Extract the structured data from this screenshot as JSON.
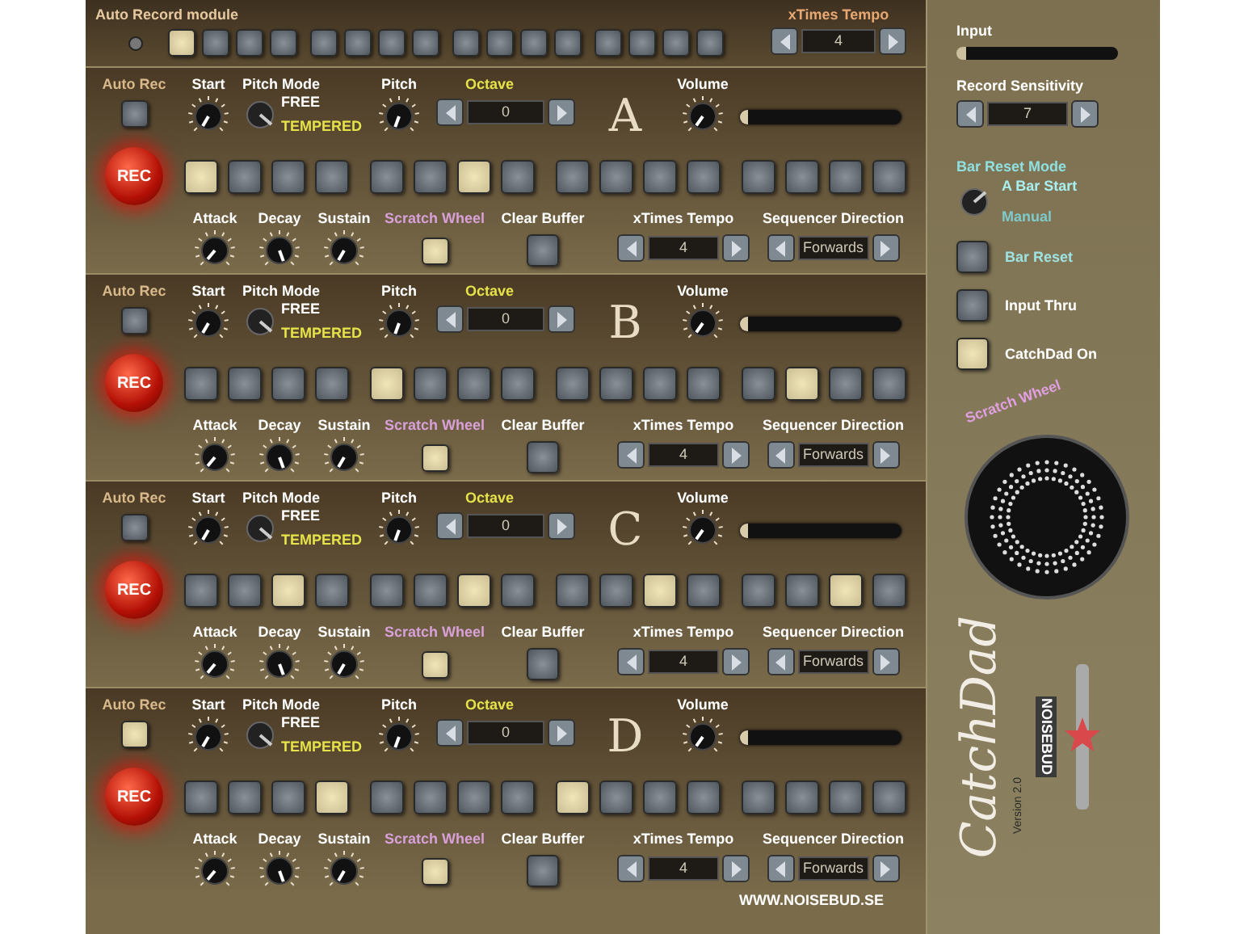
{
  "auto_record_module": {
    "title": "Auto Record module",
    "steps": [
      true,
      false,
      false,
      false,
      false,
      false,
      false,
      false,
      false,
      false,
      false,
      false,
      false,
      false,
      false,
      false
    ],
    "tempo": {
      "label": "xTimes Tempo",
      "value": "4"
    }
  },
  "tracks": [
    {
      "letter": "A",
      "volume_slider": {
        "level": 0.05
      },
      "auto_rec": {
        "label": "Auto Rec",
        "on": false
      },
      "start_label": "Start",
      "pitch_mode": {
        "label": "Pitch Mode",
        "options": [
          {
            "label": "FREE",
            "selected": false
          },
          {
            "label": "TEMPERED",
            "selected": true
          }
        ]
      },
      "pitch_label": "Pitch",
      "octave": {
        "label": "Octave",
        "value": "0"
      },
      "volume_label": "Volume",
      "rec": "REC",
      "steps": [
        true,
        false,
        false,
        false,
        false,
        false,
        true,
        false,
        false,
        false,
        false,
        false,
        false,
        false,
        false,
        false
      ],
      "attack_label": "Attack",
      "decay_label": "Decay",
      "sustain_label": "Sustain",
      "scratch_wheel": {
        "label": "Scratch Wheel",
        "on": true
      },
      "clear_buffer": "Clear Buffer",
      "tempo": {
        "label": "xTimes Tempo",
        "value": "4"
      },
      "direction": {
        "label": "Sequencer Direction",
        "value": "Forwards"
      }
    },
    {
      "letter": "B",
      "volume_slider": {
        "level": 0.05
      },
      "auto_rec": {
        "label": "Auto Rec",
        "on": false
      },
      "start_label": "Start",
      "pitch_mode": {
        "label": "Pitch Mode",
        "options": [
          {
            "label": "FREE",
            "selected": false
          },
          {
            "label": "TEMPERED",
            "selected": true
          }
        ]
      },
      "pitch_label": "Pitch",
      "octave": {
        "label": "Octave",
        "value": "0"
      },
      "volume_label": "Volume",
      "rec": "REC",
      "steps": [
        false,
        false,
        false,
        false,
        true,
        false,
        false,
        false,
        false,
        false,
        false,
        false,
        false,
        true,
        false,
        false
      ],
      "attack_label": "Attack",
      "decay_label": "Decay",
      "sustain_label": "Sustain",
      "scratch_wheel": {
        "label": "Scratch Wheel",
        "on": true
      },
      "clear_buffer": "Clear Buffer",
      "tempo": {
        "label": "xTimes Tempo",
        "value": "4"
      },
      "direction": {
        "label": "Sequencer Direction",
        "value": "Forwards"
      }
    },
    {
      "letter": "C",
      "volume_slider": {
        "level": 0.05
      },
      "auto_rec": {
        "label": "Auto Rec",
        "on": false
      },
      "start_label": "Start",
      "pitch_mode": {
        "label": "Pitch Mode",
        "options": [
          {
            "label": "FREE",
            "selected": false
          },
          {
            "label": "TEMPERED",
            "selected": true
          }
        ]
      },
      "pitch_label": "Pitch",
      "octave": {
        "label": "Octave",
        "value": "0"
      },
      "volume_label": "Volume",
      "rec": "REC",
      "steps": [
        false,
        false,
        true,
        false,
        false,
        false,
        true,
        false,
        false,
        false,
        true,
        false,
        false,
        false,
        true,
        false
      ],
      "attack_label": "Attack",
      "decay_label": "Decay",
      "sustain_label": "Sustain",
      "scratch_wheel": {
        "label": "Scratch Wheel",
        "on": true
      },
      "clear_buffer": "Clear Buffer",
      "tempo": {
        "label": "xTimes Tempo",
        "value": "4"
      },
      "direction": {
        "label": "Sequencer Direction",
        "value": "Forwards"
      }
    },
    {
      "letter": "D",
      "volume_slider": {
        "level": 0.05
      },
      "auto_rec": {
        "label": "Auto Rec",
        "on": true
      },
      "start_label": "Start",
      "pitch_mode": {
        "label": "Pitch Mode",
        "options": [
          {
            "label": "FREE",
            "selected": false
          },
          {
            "label": "TEMPERED",
            "selected": true
          }
        ]
      },
      "pitch_label": "Pitch",
      "octave": {
        "label": "Octave",
        "value": "0"
      },
      "volume_label": "Volume",
      "rec": "REC",
      "steps": [
        false,
        false,
        false,
        true,
        false,
        false,
        false,
        false,
        true,
        false,
        false,
        false,
        false,
        false,
        false,
        false
      ],
      "attack_label": "Attack",
      "decay_label": "Decay",
      "sustain_label": "Sustain",
      "scratch_wheel": {
        "label": "Scratch Wheel",
        "on": true
      },
      "clear_buffer": "Clear Buffer",
      "tempo": {
        "label": "xTimes Tempo",
        "value": "4"
      },
      "direction": {
        "label": "Sequencer Direction",
        "value": "Forwards"
      }
    }
  ],
  "website": "WWW.NOISEBUD.SE",
  "side": {
    "input_label": "Input",
    "sensitivity": {
      "label": "Record Sensitivity",
      "value": "7"
    },
    "bar_reset_mode": {
      "label": "Bar Reset Mode",
      "options": [
        {
          "label": "A Bar Start",
          "selected": true
        },
        {
          "label": "Manual",
          "selected": false
        }
      ]
    },
    "toggles": [
      {
        "label": "Bar Reset",
        "on": false
      },
      {
        "label": "Input Thru",
        "on": false
      },
      {
        "label": "CatchDad On",
        "on": true
      }
    ],
    "scratch_wheel_label": "Scratch Wheel",
    "logo": "CatchDad",
    "brand": "NOISEBUD",
    "version": "Version 2.0"
  }
}
